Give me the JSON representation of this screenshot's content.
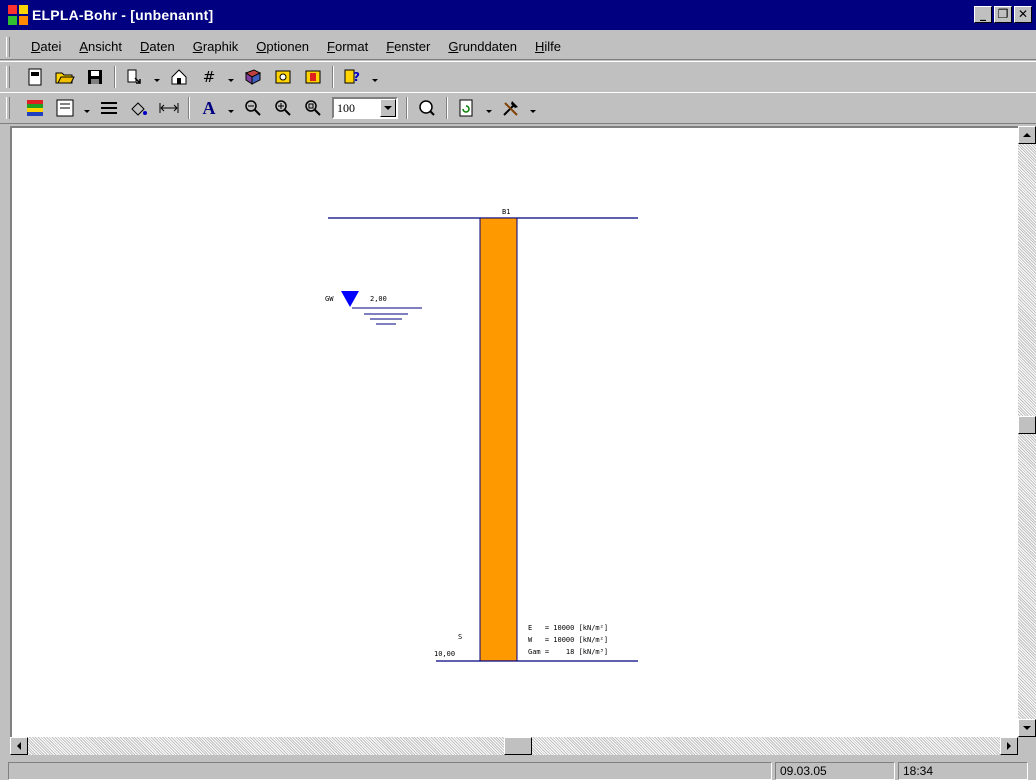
{
  "window": {
    "title": "ELPLA-Bohr - [unbenannt]",
    "buttons": [
      "_",
      "🗗",
      "✕"
    ]
  },
  "menu": {
    "items": [
      {
        "label": "Datei"
      },
      {
        "label": "Ansicht"
      },
      {
        "label": "Daten"
      },
      {
        "label": "Graphik"
      },
      {
        "label": "Optionen"
      },
      {
        "label": "Format"
      },
      {
        "label": "Fenster"
      },
      {
        "label": "Grunddaten"
      },
      {
        "label": "Hilfe"
      }
    ]
  },
  "toolbar1": {
    "icons": [
      "new-icon",
      "open-icon",
      "save-icon",
      "import-icon",
      "export-icon",
      "numbers-icon",
      "book-icon",
      "help-book-icon",
      "info-book-icon",
      "context-help-icon"
    ]
  },
  "toolbar2": {
    "icons": [
      "soil-layers-icon",
      "properties-icon",
      "line-width-icon",
      "color-icon",
      "dimension-icon",
      "font-icon",
      "zoom-out-icon",
      "zoom-in-icon",
      "zoom-window-icon",
      "preview-icon",
      "refresh-icon",
      "tools-icon"
    ],
    "zoom_value": "100"
  },
  "drawing": {
    "borehole_name": "B1",
    "groundwater_label": "GW",
    "groundwater_depth": "2,00",
    "layer_code": "S",
    "layer_bottom_depth": "10,00",
    "layer_color": "#ff9900",
    "line_color": "#000080",
    "groundwater_color": "#0000ff",
    "properties": [
      "E   = 10000 [kN/m²]",
      "W   = 10000 [kN/m²]",
      "Gam =    18 [kN/m³]"
    ]
  },
  "status": {
    "date": "09.03.05",
    "time": "18:34"
  }
}
